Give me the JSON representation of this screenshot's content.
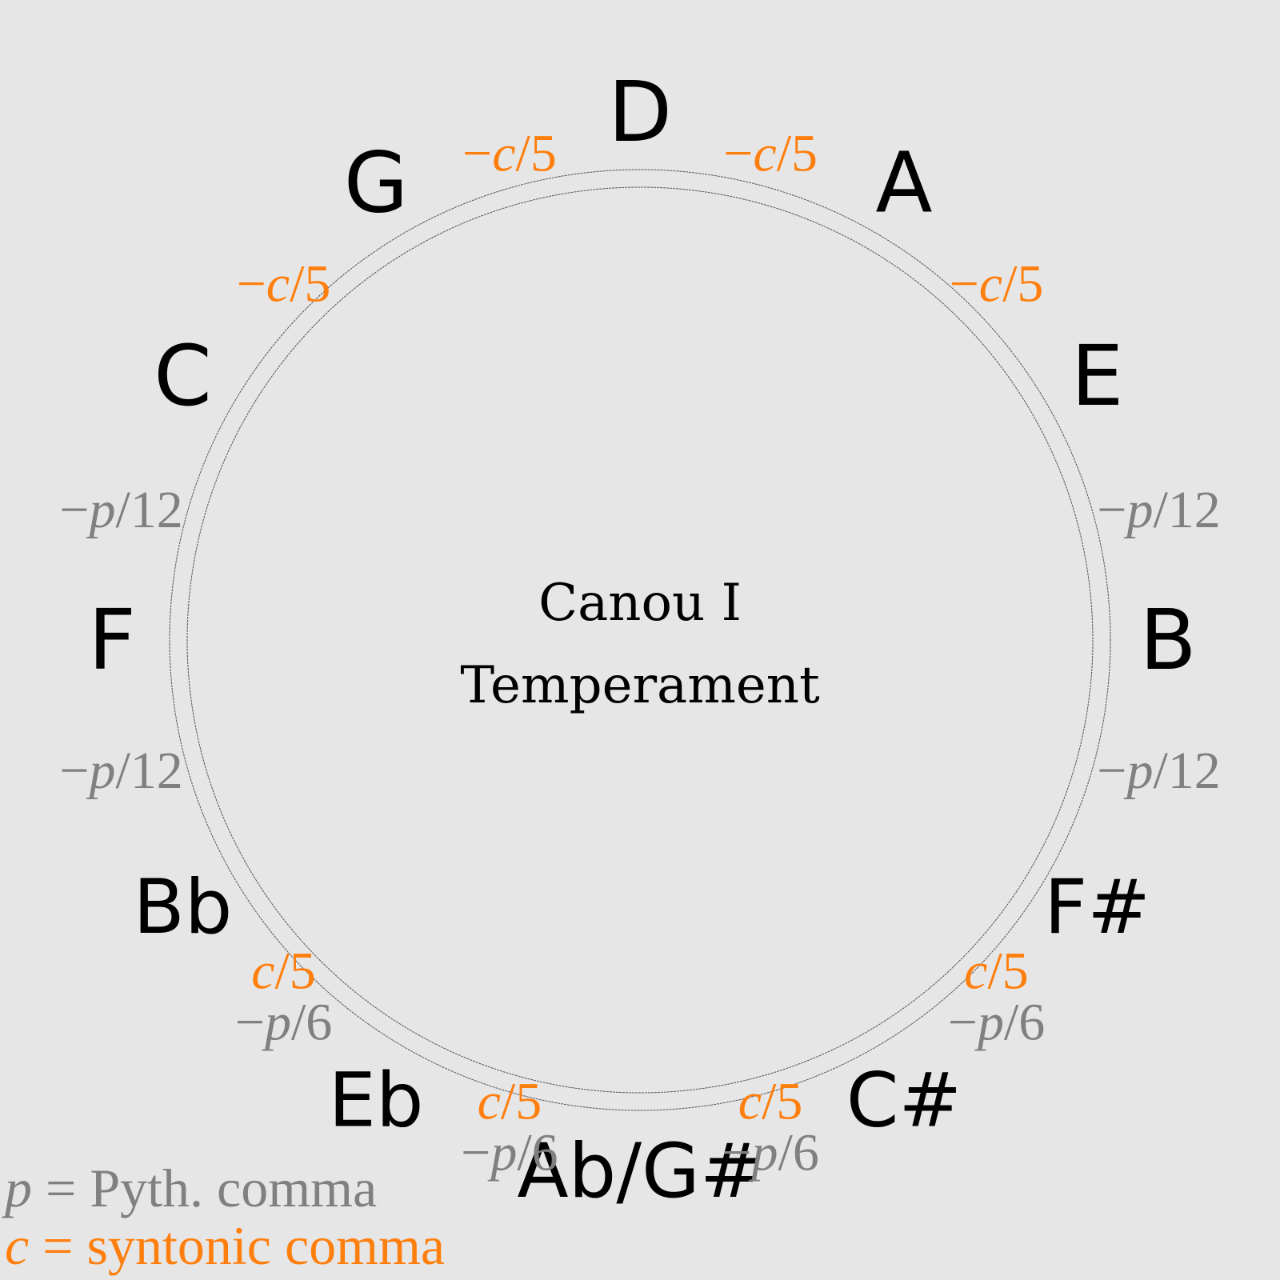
{
  "title": {
    "line1": "Canou I",
    "line2": "Temperament"
  },
  "colors": {
    "background": "#e6e6e6",
    "note_text": "#000000",
    "pythagorean": "#808080",
    "syntonic": "#ff7f0e"
  },
  "notes": [
    "D",
    "A",
    "E",
    "B",
    "F#",
    "C#",
    "Ab/G#",
    "Eb",
    "Bb",
    "F",
    "C",
    "G"
  ],
  "fifths": [
    {
      "between": "D-A",
      "lines": [
        {
          "sign": "−",
          "var": "c",
          "den": "/5",
          "kind": "syntonic"
        }
      ]
    },
    {
      "between": "A-E",
      "lines": [
        {
          "sign": "−",
          "var": "c",
          "den": "/5",
          "kind": "syntonic"
        }
      ]
    },
    {
      "between": "E-B",
      "lines": [
        {
          "sign": "−",
          "var": "p",
          "den": "/12",
          "kind": "pythagorean"
        }
      ]
    },
    {
      "between": "B-F#",
      "lines": [
        {
          "sign": "−",
          "var": "p",
          "den": "/12",
          "kind": "pythagorean"
        }
      ]
    },
    {
      "between": "F#-C#",
      "lines": [
        {
          "sign": "",
          "var": "c",
          "den": "/5",
          "kind": "syntonic"
        },
        {
          "sign": "−",
          "var": "p",
          "den": "/6",
          "kind": "pythagorean"
        }
      ]
    },
    {
      "between": "C#-Ab",
      "lines": [
        {
          "sign": "",
          "var": "c",
          "den": "/5",
          "kind": "syntonic"
        },
        {
          "sign": "−",
          "var": "p",
          "den": "/6",
          "kind": "pythagorean"
        }
      ]
    },
    {
      "between": "Ab-Eb",
      "lines": [
        {
          "sign": "",
          "var": "c",
          "den": "/5",
          "kind": "syntonic"
        },
        {
          "sign": "−",
          "var": "p",
          "den": "/6",
          "kind": "pythagorean"
        }
      ]
    },
    {
      "between": "Eb-Bb",
      "lines": [
        {
          "sign": "",
          "var": "c",
          "den": "/5",
          "kind": "syntonic"
        },
        {
          "sign": "−",
          "var": "p",
          "den": "/6",
          "kind": "pythagorean"
        }
      ]
    },
    {
      "between": "Bb-F",
      "lines": [
        {
          "sign": "−",
          "var": "p",
          "den": "/12",
          "kind": "pythagorean"
        }
      ]
    },
    {
      "between": "F-C",
      "lines": [
        {
          "sign": "−",
          "var": "p",
          "den": "/12",
          "kind": "pythagorean"
        }
      ]
    },
    {
      "between": "C-G",
      "lines": [
        {
          "sign": "−",
          "var": "c",
          "den": "/5",
          "kind": "syntonic"
        }
      ]
    },
    {
      "between": "G-D",
      "lines": [
        {
          "sign": "−",
          "var": "c",
          "den": "/5",
          "kind": "syntonic"
        }
      ]
    }
  ],
  "legend": [
    {
      "var": "p",
      "text": " = Pyth. comma",
      "kind": "pythagorean"
    },
    {
      "var": "c",
      "text": " = syntonic comma",
      "kind": "syntonic"
    }
  ]
}
